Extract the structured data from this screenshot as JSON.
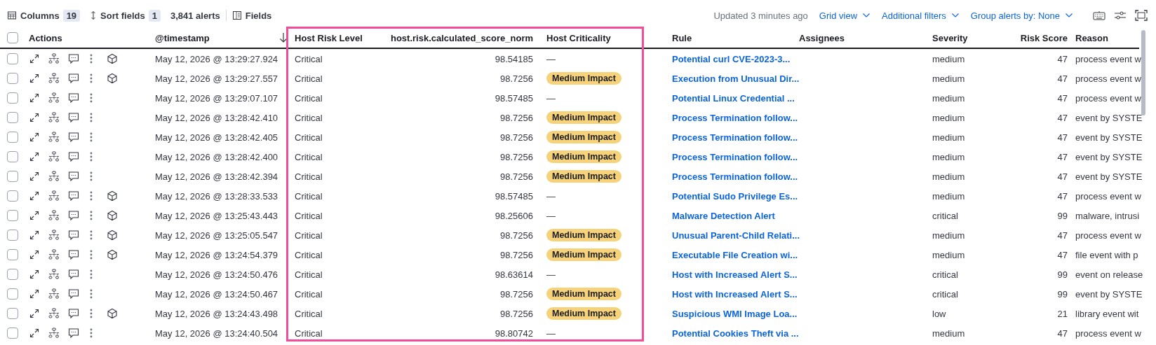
{
  "toolbar": {
    "columns_label": "Columns",
    "columns_count": "19",
    "sort_label": "Sort fields",
    "sort_count": "1",
    "alert_count": "3,841 alerts",
    "fields_label": "Fields",
    "updated": "Updated 3 minutes ago",
    "menus": [
      "Grid view",
      "Additional filters",
      "Group alerts by: None"
    ]
  },
  "table": {
    "select_all_checked": false,
    "columns": [
      {
        "label": "Actions",
        "sorted": false
      },
      {
        "label": "@timestamp",
        "sorted": true
      },
      {
        "label": "Host Risk Level",
        "sorted": false
      },
      {
        "label": "host.risk.calculated_score_norm",
        "sorted": false
      },
      {
        "label": "Host Criticality",
        "sorted": false
      },
      {
        "label": "Rule",
        "sorted": false
      },
      {
        "label": "Assignees",
        "sorted": false
      },
      {
        "label": "Severity",
        "sorted": false
      },
      {
        "label": "Risk Score",
        "sorted": false
      },
      {
        "label": "Reason",
        "sorted": false
      }
    ],
    "rows": [
      {
        "checked": false,
        "cube": true,
        "timestamp": "May 12, 2026 @ 13:29:27.924",
        "risk_level": "Critical",
        "score": "98.54185",
        "criticality": {
          "kind": "text",
          "text": "—"
        },
        "rule": "Potential curl CVE-2023-3...",
        "severity": "medium",
        "risk_score": "47",
        "reason": "process event w"
      },
      {
        "checked": false,
        "cube": true,
        "timestamp": "May 12, 2026 @ 13:29:27.557",
        "risk_level": "Critical",
        "score": "98.7256",
        "criticality": {
          "kind": "badge",
          "text": "Medium Impact"
        },
        "rule": "Execution from Unusual Dir...",
        "severity": "medium",
        "risk_score": "47",
        "reason": "process event w"
      },
      {
        "checked": false,
        "cube": false,
        "timestamp": "May 12, 2026 @ 13:29:07.107",
        "risk_level": "Critical",
        "score": "98.57485",
        "criticality": {
          "kind": "text",
          "text": "—"
        },
        "rule": "Potential Linux Credential ...",
        "severity": "medium",
        "risk_score": "47",
        "reason": "process event w"
      },
      {
        "checked": false,
        "cube": false,
        "timestamp": "May 12, 2026 @ 13:28:42.410",
        "risk_level": "Critical",
        "score": "98.7256",
        "criticality": {
          "kind": "badge",
          "text": "Medium Impact"
        },
        "rule": "Process Termination follow...",
        "severity": "medium",
        "risk_score": "47",
        "reason": "event by SYSTE"
      },
      {
        "checked": false,
        "cube": false,
        "timestamp": "May 12, 2026 @ 13:28:42.405",
        "risk_level": "Critical",
        "score": "98.7256",
        "criticality": {
          "kind": "badge",
          "text": "Medium Impact"
        },
        "rule": "Process Termination follow...",
        "severity": "medium",
        "risk_score": "47",
        "reason": "event by SYSTE"
      },
      {
        "checked": false,
        "cube": false,
        "timestamp": "May 12, 2026 @ 13:28:42.400",
        "risk_level": "Critical",
        "score": "98.7256",
        "criticality": {
          "kind": "badge",
          "text": "Medium Impact"
        },
        "rule": "Process Termination follow...",
        "severity": "medium",
        "risk_score": "47",
        "reason": "event by SYSTE"
      },
      {
        "checked": false,
        "cube": false,
        "timestamp": "May 12, 2026 @ 13:28:42.394",
        "risk_level": "Critical",
        "score": "98.7256",
        "criticality": {
          "kind": "badge",
          "text": "Medium Impact"
        },
        "rule": "Process Termination follow...",
        "severity": "medium",
        "risk_score": "47",
        "reason": "event by SYSTE"
      },
      {
        "checked": false,
        "cube": true,
        "timestamp": "May 12, 2026 @ 13:28:33.533",
        "risk_level": "Critical",
        "score": "98.57485",
        "criticality": {
          "kind": "text",
          "text": "—"
        },
        "rule": "Potential Sudo Privilege Es...",
        "severity": "medium",
        "risk_score": "47",
        "reason": "process event w"
      },
      {
        "checked": false,
        "cube": true,
        "timestamp": "May 12, 2026 @ 13:25:43.443",
        "risk_level": "Critical",
        "score": "98.25606",
        "criticality": {
          "kind": "text",
          "text": "—"
        },
        "rule": "Malware Detection Alert",
        "severity": "critical",
        "risk_score": "99",
        "reason": "malware, intrusi"
      },
      {
        "checked": false,
        "cube": true,
        "timestamp": "May 12, 2026 @ 13:25:05.547",
        "risk_level": "Critical",
        "score": "98.7256",
        "criticality": {
          "kind": "badge",
          "text": "Medium Impact"
        },
        "rule": "Unusual Parent-Child Relati...",
        "severity": "medium",
        "risk_score": "47",
        "reason": "process event w"
      },
      {
        "checked": false,
        "cube": true,
        "timestamp": "May 12, 2026 @ 13:24:54.379",
        "risk_level": "Critical",
        "score": "98.7256",
        "criticality": {
          "kind": "badge",
          "text": "Medium Impact"
        },
        "rule": "Executable File Creation wi...",
        "severity": "medium",
        "risk_score": "47",
        "reason": "file event with p"
      },
      {
        "checked": false,
        "cube": false,
        "timestamp": "May 12, 2026 @ 13:24:50.476",
        "risk_level": "Critical",
        "score": "98.63614",
        "criticality": {
          "kind": "text",
          "text": "—"
        },
        "rule": "Host with Increased Alert S...",
        "severity": "critical",
        "risk_score": "99",
        "reason": "event on release"
      },
      {
        "checked": false,
        "cube": false,
        "timestamp": "May 12, 2026 @ 13:24:50.467",
        "risk_level": "Critical",
        "score": "98.7256",
        "criticality": {
          "kind": "badge",
          "text": "Medium Impact"
        },
        "rule": "Host with Increased Alert S...",
        "severity": "critical",
        "risk_score": "99",
        "reason": "event by SYSTE"
      },
      {
        "checked": false,
        "cube": true,
        "timestamp": "May 12, 2026 @ 13:24:43.498",
        "risk_level": "Critical",
        "score": "98.7256",
        "criticality": {
          "kind": "badge",
          "text": "Medium Impact"
        },
        "rule": "Suspicious WMI Image Loa...",
        "severity": "low",
        "risk_score": "21",
        "reason": "library event wit"
      },
      {
        "checked": false,
        "cube": false,
        "timestamp": "May 12, 2026 @ 13:24:40.504",
        "risk_level": "Critical",
        "score": "98.80742",
        "criticality": {
          "kind": "text",
          "text": "—"
        },
        "rule": "Potential Cookies Theft via ...",
        "severity": "medium",
        "risk_score": "47",
        "reason": "process event w"
      }
    ]
  }
}
